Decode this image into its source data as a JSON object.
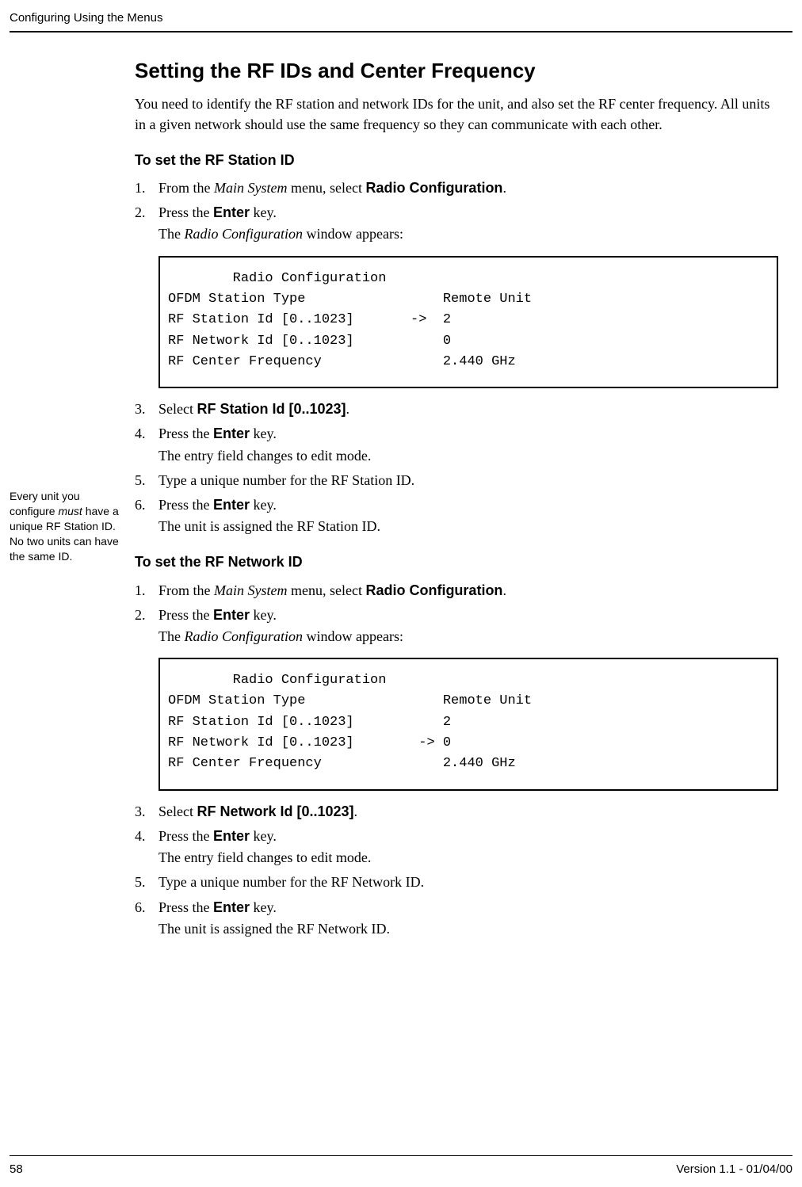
{
  "header": {
    "title": "Configuring Using the Menus"
  },
  "h1": "Setting the RF IDs and Center Frequency",
  "intro": "You need to identify the RF station and network IDs for the unit, and also set the RF center frequency. All units in a given network should use the same frequency so they can communicate with each other.",
  "section1": {
    "heading": "To set the RF Station ID",
    "steps": {
      "s1_pre": "From the ",
      "s1_italic": "Main System",
      "s1_mid": " menu, select ",
      "s1_bold": "Radio Configuration",
      "s1_post": ".",
      "s2_pre": "Press the ",
      "s2_bold": "Enter",
      "s2_post": " key.",
      "s2_sub_pre": "The ",
      "s2_sub_italic": "Radio Configuration",
      "s2_sub_post": " window appears:",
      "s3_pre": "Select ",
      "s3_bold": "RF Station Id [0..1023]",
      "s3_post": ".",
      "s4_pre": "Press the ",
      "s4_bold": "Enter",
      "s4_post": " key.",
      "s4_sub": "The entry field changes to edit mode.",
      "s5": "Type a unique number for the RF Station ID.",
      "s6_pre": "Press the ",
      "s6_bold": "Enter",
      "s6_post": " key.",
      "s6_sub": "The unit is assigned the RF Station ID."
    },
    "code": "        Radio Configuration\nOFDM Station Type                 Remote Unit\nRF Station Id [0..1023]       ->  2\nRF Network Id [0..1023]           0\nRF Center Frequency               2.440 GHz"
  },
  "margin_note": {
    "l1": "Every unit you configure ",
    "italic": "must",
    "l2": " have a unique RF Station ID. No two units can have the same ID."
  },
  "section2": {
    "heading": "To set the RF Network ID",
    "steps": {
      "s1_pre": "From the ",
      "s1_italic": "Main System",
      "s1_mid": " menu, select ",
      "s1_bold": "Radio Configuration",
      "s1_post": ".",
      "s2_pre": "Press the ",
      "s2_bold": "Enter",
      "s2_post": " key.",
      "s2_sub_pre": "The ",
      "s2_sub_italic": "Radio Configuration",
      "s2_sub_post": " window appears:",
      "s3_pre": "Select ",
      "s3_bold": "RF Network Id [0..1023]",
      "s3_post": ".",
      "s4_pre": "Press the ",
      "s4_bold": "Enter",
      "s4_post": " key.",
      "s4_sub": "The entry field changes to edit mode.",
      "s5": "Type a unique number for the RF Network ID.",
      "s6_pre": "Press the ",
      "s6_bold": "Enter",
      "s6_post": " key.",
      "s6_sub": "The unit is assigned the RF Network ID."
    },
    "code": "        Radio Configuration\nOFDM Station Type                 Remote Unit\nRF Station Id [0..1023]           2\nRF Network Id [0..1023]        -> 0\nRF Center Frequency               2.440 GHz"
  },
  "footer": {
    "page": "58",
    "version": "Version 1.1 - 01/04/00"
  }
}
